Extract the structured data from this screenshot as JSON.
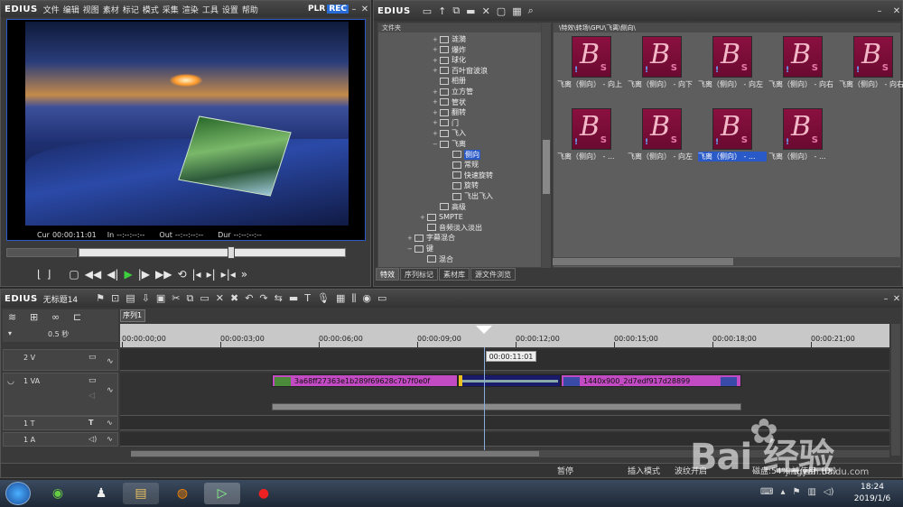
{
  "player": {
    "logo": "EDIUS",
    "menu": [
      "文件",
      "编辑",
      "视图",
      "素材",
      "标记",
      "模式",
      "采集",
      "渲染",
      "工具",
      "设置",
      "帮助"
    ],
    "plr": "PLR",
    "rec": "REC",
    "timecodes": {
      "cur_label": "Cur",
      "cur": "00:00:11:01",
      "in_label": "In",
      "in": "--:--:--:--",
      "out_label": "Out",
      "out": "--:--:--:--",
      "dur_label": "Dur",
      "dur": "--:--:--:--"
    },
    "scrub_position": 0.57
  },
  "bin": {
    "logo": "EDIUS",
    "folder_header": "文件夹",
    "path": "\\特效\\转场\\GPU\\飞离\\侧向\\",
    "tree": [
      {
        "label": "涟漪",
        "level": 1,
        "expander": "+"
      },
      {
        "label": "爆炸",
        "level": 1,
        "expander": "+"
      },
      {
        "label": "球化",
        "level": 1,
        "expander": "+"
      },
      {
        "label": "百叶窗波浪",
        "level": 1,
        "expander": "+"
      },
      {
        "label": "相册",
        "level": 1,
        "expander": ""
      },
      {
        "label": "立方管",
        "level": 1,
        "expander": "+"
      },
      {
        "label": "管状",
        "level": 1,
        "expander": "+"
      },
      {
        "label": "翻转",
        "level": 1,
        "expander": "+"
      },
      {
        "label": "门",
        "level": 1,
        "expander": "+"
      },
      {
        "label": "飞入",
        "level": 1,
        "expander": "+"
      },
      {
        "label": "飞离",
        "level": 1,
        "expander": "−"
      },
      {
        "label": "侧向",
        "level": 2,
        "expander": "",
        "selected": true
      },
      {
        "label": "常规",
        "level": 2,
        "expander": ""
      },
      {
        "label": "快速旋转",
        "level": 2,
        "expander": ""
      },
      {
        "label": "旋转",
        "level": 2,
        "expander": ""
      },
      {
        "label": "飞出飞入",
        "level": 2,
        "expander": ""
      },
      {
        "label": "高级",
        "level": 1,
        "expander": ""
      },
      {
        "label": "SMPTE",
        "level": 0,
        "expander": "+"
      },
      {
        "label": "音频淡入淡出",
        "level": 0,
        "expander": ""
      },
      {
        "label": "字幕混合",
        "level": -1,
        "expander": "+"
      },
      {
        "label": "键",
        "level": -1,
        "expander": "−"
      },
      {
        "label": "混合",
        "level": 0,
        "expander": ""
      }
    ],
    "tabs": [
      "特效",
      "序列标记",
      "素材库",
      "源文件浏览"
    ],
    "clips": [
      {
        "caption": "飞离（侧向） - 向上"
      },
      {
        "caption": "飞离（侧向） - 向下"
      },
      {
        "caption": "飞离（侧向） - 向左"
      },
      {
        "caption": "飞离（侧向） - 向右"
      },
      {
        "caption": "飞离（侧向） - 向右"
      },
      {
        "caption": "飞离（侧向） - ..."
      },
      {
        "caption": "飞离（侧向） - 向左"
      },
      {
        "caption": "飞离（侧向） - ...",
        "selected": true
      },
      {
        "caption": "飞离（侧向） - ..."
      }
    ]
  },
  "timeline": {
    "logo": "EDIUS",
    "project": "无标题14",
    "sequence_tab": "序列1",
    "zoom": "0.5 秒",
    "ruler_ticks": [
      "00:00:00;00",
      "00:00:03;00",
      "00:00:06;00",
      "00:00:09;00",
      "00:00:12;00",
      "00:00:15;00",
      "00:00:18;00",
      "00:00:21;00"
    ],
    "playhead_tc": "00:00:11:01",
    "tracks": [
      {
        "name": "2 V"
      },
      {
        "name": "1 VA"
      },
      {
        "name": "1 T"
      },
      {
        "name": "1 A"
      }
    ],
    "clip_a_name": "3a68ff27363e1b289f69628c7b7f0e0f",
    "clip_c_name": "1440x900_2d7edf917d28899",
    "status": {
      "pause": "暂停",
      "insert_mode": "插入模式",
      "ripple": "波纹开启",
      "disk": "磁盘:54% 被使用（D:）"
    }
  },
  "taskbar": {
    "time": "18:24",
    "date": "2019/1/6"
  },
  "watermark": {
    "site": "jingyan.baidu.com"
  },
  "colors": {
    "accent": "#2a5ac8",
    "clip": "#c24ac2",
    "play": "#3ecf3e"
  }
}
